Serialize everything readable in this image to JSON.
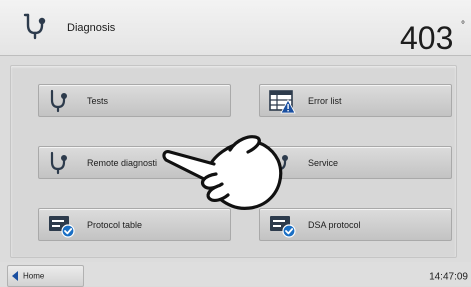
{
  "header": {
    "title": "Diagnosis",
    "icon": "stethoscope-icon",
    "temperature": "403",
    "temperature_unit": "°"
  },
  "tiles": [
    {
      "label": "Tests",
      "icon": "stethoscope-icon"
    },
    {
      "label": "Error list",
      "icon": "error-list-icon"
    },
    {
      "label": "Remote diagnosti",
      "icon": "stethoscope-icon"
    },
    {
      "label": "Service",
      "icon": "stethoscope-icon"
    },
    {
      "label": "Protocol table",
      "icon": "protocol-icon"
    },
    {
      "label": "DSA protocol",
      "icon": "protocol-icon"
    }
  ],
  "footer": {
    "home_label": "Home",
    "time": "14:47:09"
  },
  "colors": {
    "accent_blue": "#1a4fa0",
    "icon_dark": "#2d3b4c"
  }
}
